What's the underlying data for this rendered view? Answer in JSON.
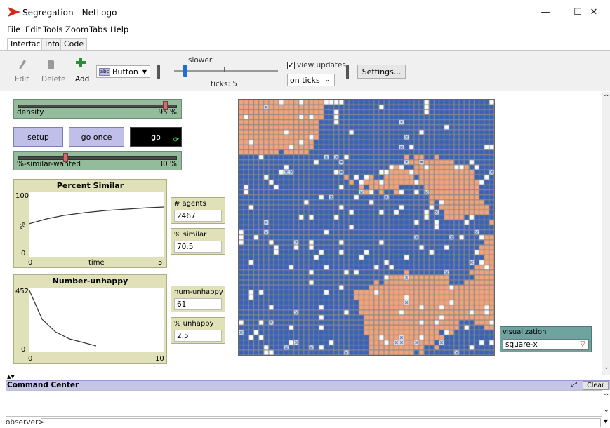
{
  "window": {
    "title": "Segregation - NetLogo",
    "minimize_glyph": "—",
    "maximize_glyph": "☐",
    "close_glyph": "✕"
  },
  "menu": [
    "File",
    "Edit",
    "Tools",
    "Zoom",
    "Tabs",
    "Help"
  ],
  "tabs": [
    {
      "label": "Interface",
      "active": true
    },
    {
      "label": "Info",
      "active": false
    },
    {
      "label": "Code",
      "active": false
    }
  ],
  "toolbar": {
    "edit_label": "Edit",
    "delete_label": "Delete",
    "add_label": "Add",
    "widget_type": "Button",
    "widget_type_abc": "abc",
    "speed_label": "slower",
    "ticks_text": "ticks: 5",
    "view_updates_label": "view updates",
    "view_updates_checked": true,
    "update_mode": "on ticks",
    "settings_label": "Settings..."
  },
  "widgets": {
    "density": {
      "label": "density",
      "value": "95 %",
      "fraction": 0.95
    },
    "setup_label": "setup",
    "go_once_label": "go once",
    "go_label": "go",
    "similar_wanted": {
      "label": "%-similar-wanted",
      "value": "30 %",
      "fraction": 0.3
    },
    "plot_similar": {
      "title": "Percent Similar",
      "ymax": "100",
      "ymin": "0",
      "xmin": "0",
      "xmax": "5",
      "xlabel": "time",
      "ylabel": "%"
    },
    "plot_unhappy": {
      "title": "Number-unhappy",
      "ymax": "452",
      "ymin": "0",
      "xmin": "0",
      "xmax": "10"
    },
    "monitors": [
      {
        "label": "# agents",
        "value": "2467"
      },
      {
        "label": "% similar",
        "value": "70.5"
      },
      {
        "label": "num-unhappy",
        "value": "61"
      },
      {
        "label": "% unhappy",
        "value": "2.5"
      }
    ],
    "chooser": {
      "label": "visualization",
      "value": "square-x"
    }
  },
  "command_center": {
    "title": "Command Center",
    "clear_label": "Clear",
    "prompt": "observer>"
  },
  "colors": {
    "blue_agent": "#3a63b5",
    "orange_agent": "#f2a37a",
    "empty_patch": "#ffffff"
  }
}
